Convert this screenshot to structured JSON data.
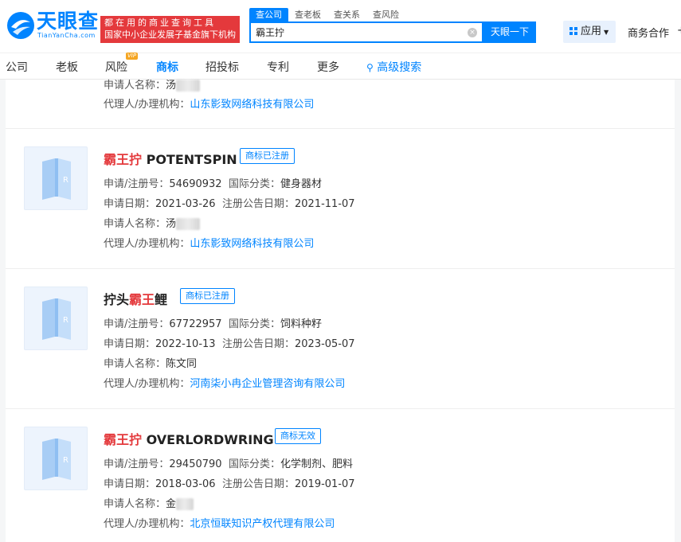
{
  "header": {
    "logo_text": "天眼查",
    "logo_sub": "TianYanCha.com",
    "slogan_line1": "都在用的商业查询工具",
    "slogan_line2": "国家中小企业发展子基金旗下机构",
    "search_tabs": [
      "查公司",
      "查老板",
      "查关系",
      "查风险"
    ],
    "search_value": "霸王拧",
    "clear_label": "×",
    "search_button": "天眼一下",
    "app_button": "应用",
    "coop": "商务合作",
    "coop_more": "+"
  },
  "nav": {
    "items": [
      "公司",
      "老板",
      "风险",
      "商标",
      "招投标",
      "专利",
      "更多",
      "高级搜索"
    ],
    "active": "商标",
    "vip_badge": "VIP"
  },
  "labels": {
    "reg_no": "申请/注册号：",
    "intl_class": "国际分类：",
    "apply_date": "申请日期：",
    "announce_date": "注册公告日期：",
    "applicant": "申请人名称：",
    "agent": "代理人/办理机构："
  },
  "cards": [
    {
      "partial": true,
      "applicant_partial": "汤",
      "agent": "山东影致网络科技有限公司"
    },
    {
      "title_hl": "霸王拧",
      "title_rest": " POTENTSPIN",
      "status": "商标已注册",
      "reg_no": "54690932",
      "intl_class": "健身器材",
      "apply_date": "2021-03-26",
      "announce_date": "2021-11-07",
      "applicant": "汤",
      "agent": "山东影致网络科技有限公司"
    },
    {
      "title_pre": "拧头",
      "title_hl": "霸王",
      "title_rest": "鲤",
      "status": "商标已注册",
      "reg_no": "67722957",
      "intl_class": "饲料种籽",
      "apply_date": "2022-10-13",
      "announce_date": "2023-05-07",
      "applicant": "陈文同",
      "agent": "河南柒小冉企业管理咨询有限公司"
    },
    {
      "title_hl": "霸王拧",
      "title_rest": " OVERLORDWRING",
      "status": "商标无效",
      "reg_no": "29450790",
      "intl_class": "化学制剂、肥料",
      "apply_date": "2018-03-06",
      "announce_date": "2019-01-07",
      "applicant": "金",
      "agent": "北京恒联知识产权代理有限公司"
    }
  ],
  "colors": {
    "brand": "#0084ff",
    "highlight": "#e4393c",
    "slogan_bg": "#e4393c"
  }
}
